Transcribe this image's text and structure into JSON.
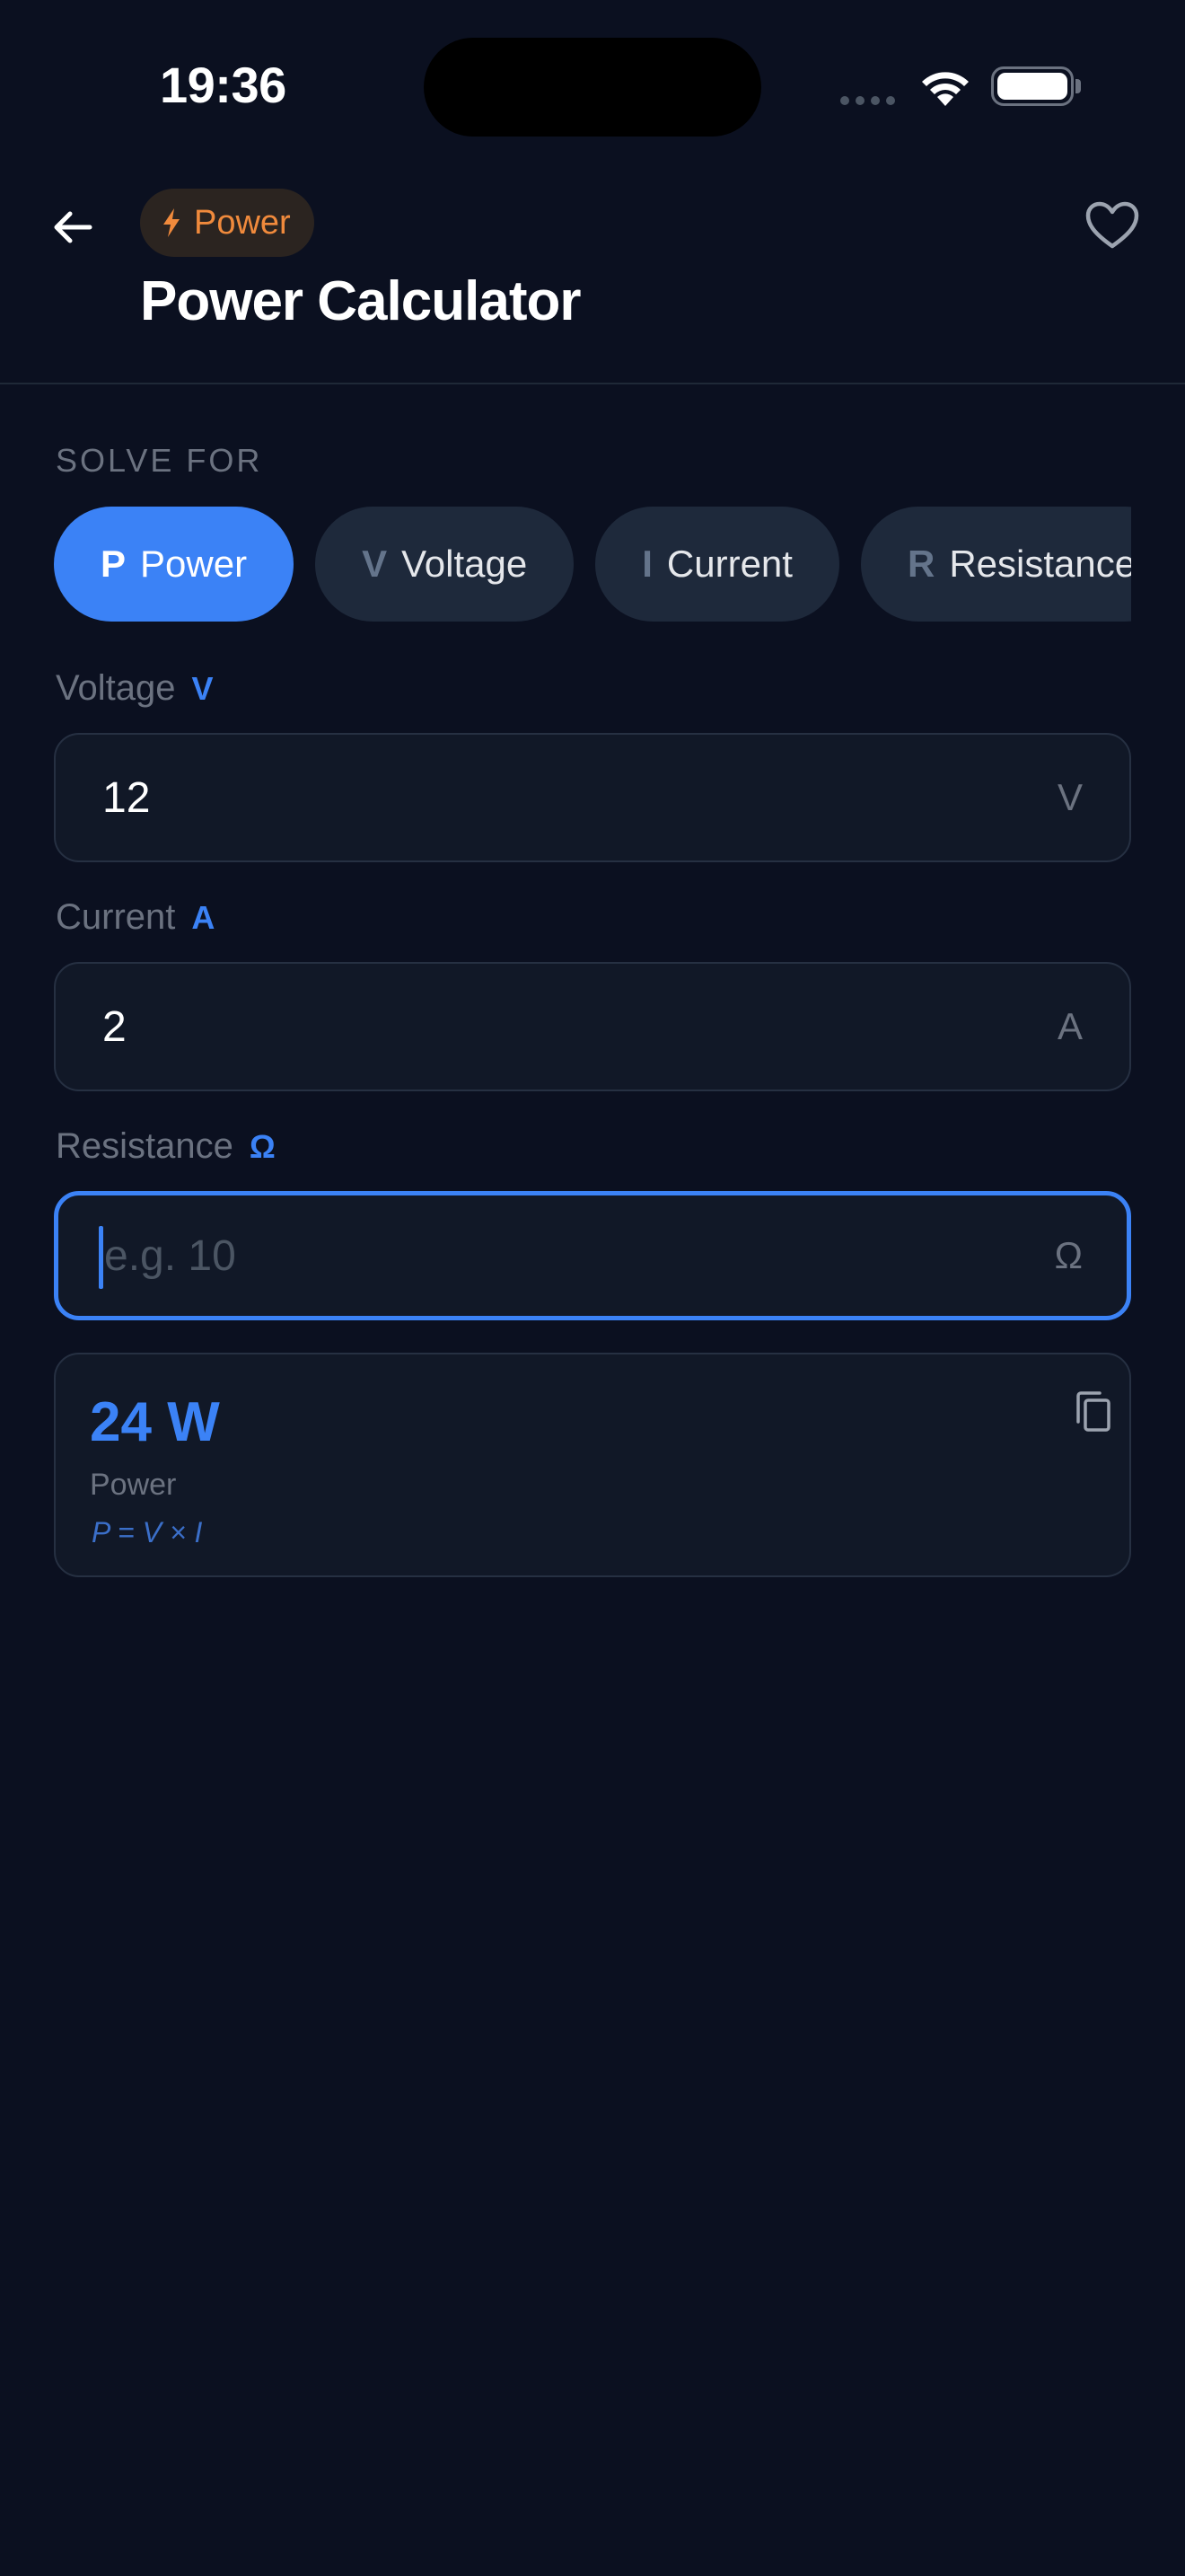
{
  "status_bar": {
    "time": "19:36"
  },
  "header": {
    "category_label": "Power",
    "title": "Power Calculator",
    "accent_color": "#f08a3c"
  },
  "solve_for": {
    "label": "SOLVE FOR",
    "options": [
      {
        "symbol": "P",
        "label": "Power",
        "selected": true
      },
      {
        "symbol": "V",
        "label": "Voltage",
        "selected": false
      },
      {
        "symbol": "I",
        "label": "Current",
        "selected": false
      },
      {
        "symbol": "R",
        "label": "Resistance",
        "selected": false
      }
    ]
  },
  "fields": {
    "voltage": {
      "label": "Voltage",
      "symbol": "V",
      "value": "12",
      "unit": "V"
    },
    "current": {
      "label": "Current",
      "symbol": "A",
      "value": "2",
      "unit": "A"
    },
    "resistance": {
      "label": "Resistance",
      "symbol": "Ω",
      "value": "",
      "placeholder": "e.g. 10",
      "unit": "Ω"
    }
  },
  "result": {
    "value": "24 W",
    "label": "Power",
    "formula": "P = V × I"
  },
  "colors": {
    "background": "#0b1020",
    "primary": "#3b82f6",
    "surface": "#111827"
  }
}
